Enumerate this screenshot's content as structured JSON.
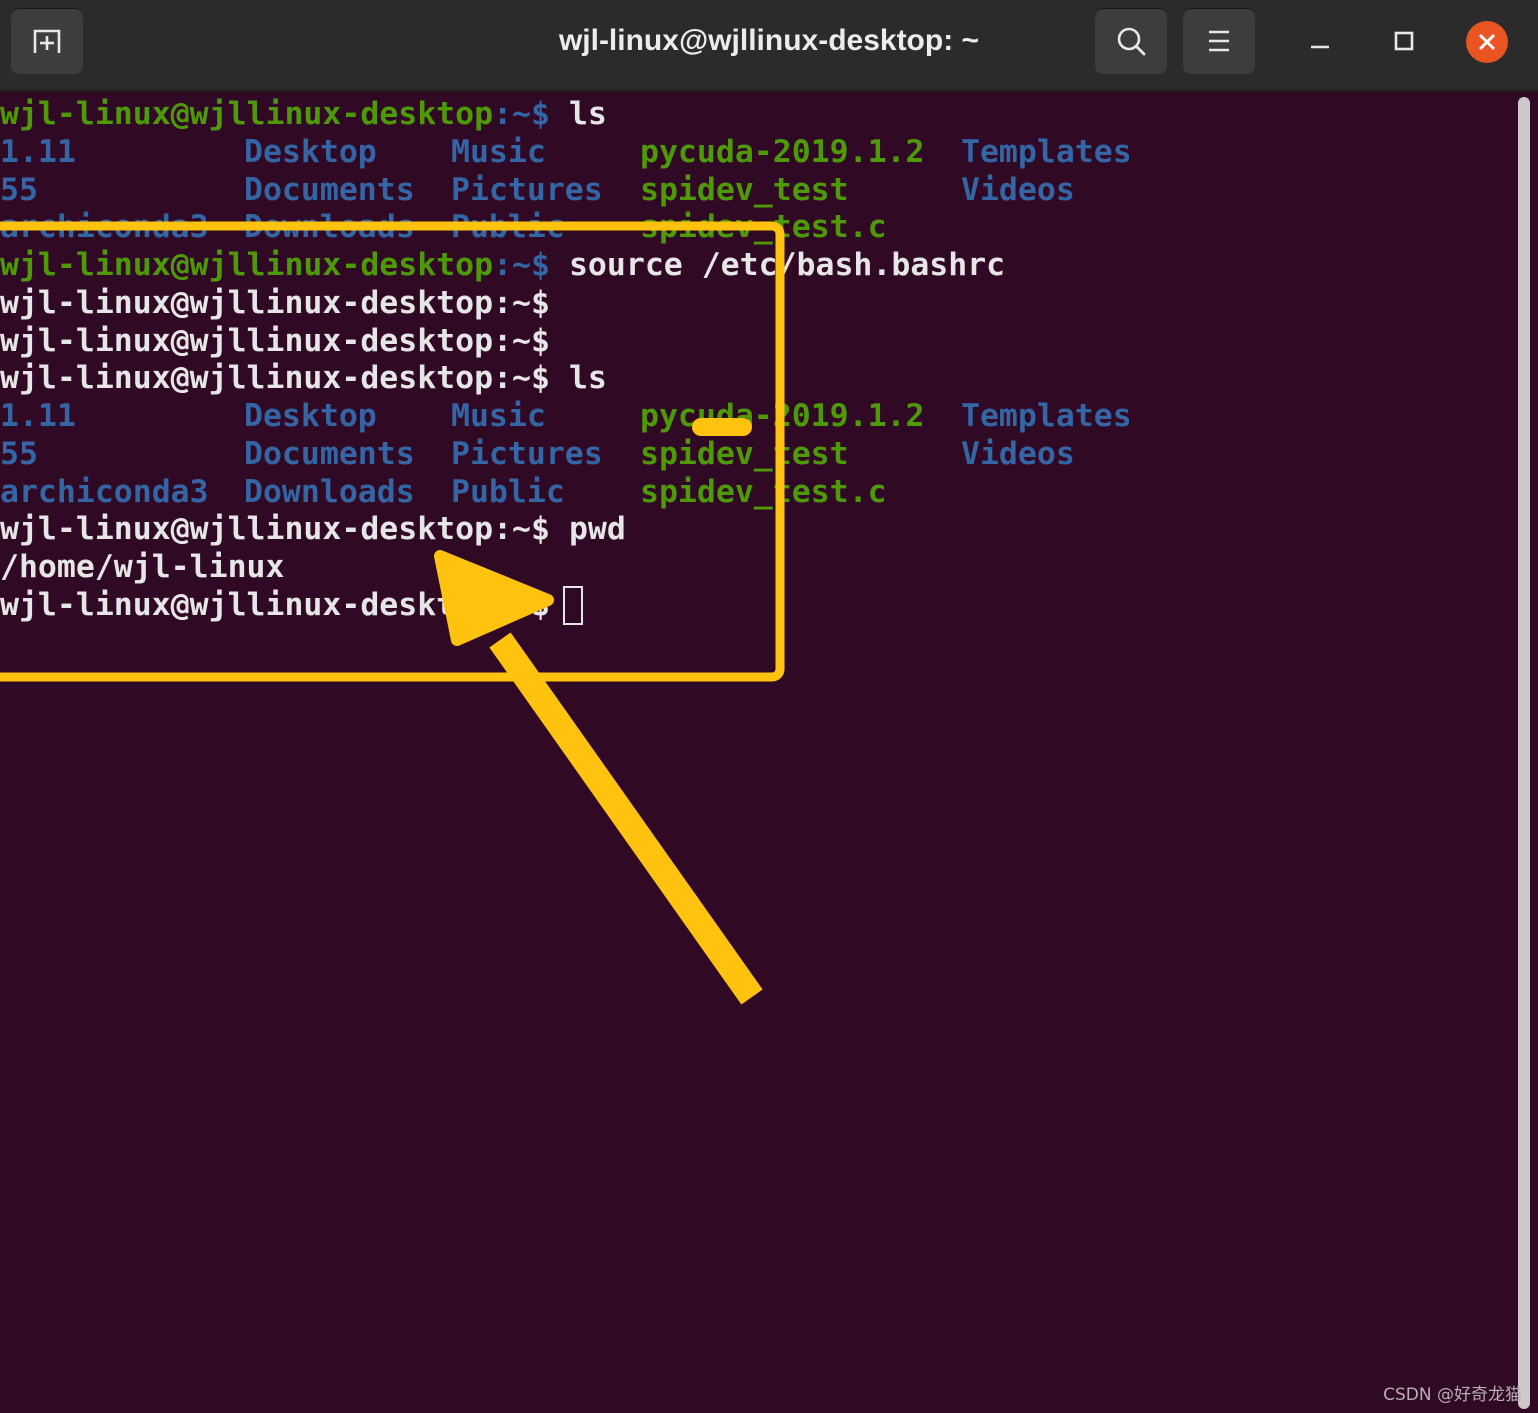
{
  "window": {
    "title": "wjl-linux@wjllinux-desktop: ~",
    "new_tab_icon": "new-tab-icon",
    "search_icon": "search-icon",
    "menu_icon": "hamburger-menu-icon",
    "minimize_icon": "minimize-icon",
    "maximize_icon": "maximize-icon",
    "close_icon": "close-icon",
    "close_color": "#e95420"
  },
  "terminal": {
    "prompt": "wjl-linux@wjllinux-desktop",
    "prompt_suffix": ":~$",
    "lines": [
      {
        "type": "prompt",
        "command": " ls"
      },
      {
        "type": "ls",
        "cols": [
          "1.11",
          "Desktop",
          "Music",
          "pycuda-2019.1.2",
          "Templates"
        ]
      },
      {
        "type": "ls",
        "cols": [
          "55",
          "Documents",
          "Pictures",
          "spidev_test",
          "Videos"
        ]
      },
      {
        "type": "ls",
        "cols": [
          "archiconda3",
          "Downloads",
          "Public",
          "spidev_test.c",
          ""
        ]
      },
      {
        "type": "prompt",
        "command": " source /etc/bash.bashrc"
      },
      {
        "type": "plain",
        "text": "wjl-linux@wjllinux-desktop:~$"
      },
      {
        "type": "plain",
        "text": "wjl-linux@wjllinux-desktop:~$"
      },
      {
        "type": "plain",
        "text": "wjl-linux@wjllinux-desktop:~$ ls"
      },
      {
        "type": "ls",
        "cols": [
          "1.11",
          "Desktop",
          "Music",
          "pycuda-2019.1.2",
          "Templates"
        ]
      },
      {
        "type": "ls",
        "cols": [
          "55",
          "Documents",
          "Pictures",
          "spidev_test",
          "Videos"
        ]
      },
      {
        "type": "ls",
        "cols": [
          "archiconda3",
          "Downloads",
          "Public",
          "spidev_test.c",
          ""
        ]
      },
      {
        "type": "plain",
        "text": "wjl-linux@wjllinux-desktop:~$ pwd"
      },
      {
        "type": "plain",
        "text": "/home/wjl-linux"
      },
      {
        "type": "plain",
        "text": "wjl-linux@wjllinux-desktop:~$ "
      }
    ],
    "colors": {
      "background": "#300a24",
      "prompt_user": "#4e9a06",
      "directory": "#3465a4",
      "executable": "#4e9a06",
      "text": "#e6e6e6"
    }
  },
  "annotation": {
    "highlight_color": "#ffc20e"
  },
  "watermark": "CSDN @好奇龙猫"
}
